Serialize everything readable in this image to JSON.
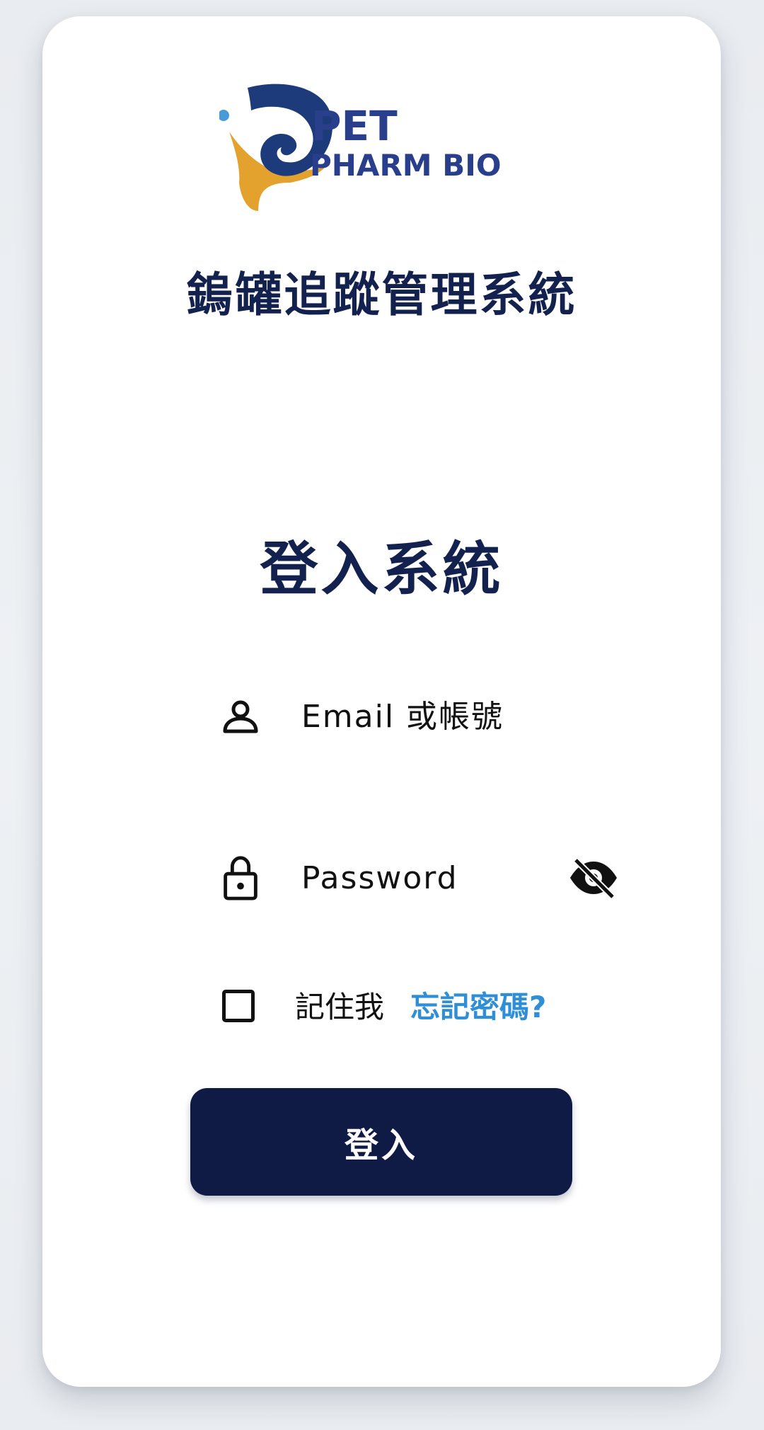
{
  "brand": {
    "logo_icon": "pet-pharm-bio-logo",
    "logo_line1": "PET",
    "logo_line2": "PHARM BIO",
    "colors": {
      "navy": "#13214f",
      "gold": "#e3a12e",
      "accent_blue": "#2f8fd6",
      "button": "#0f1a45"
    }
  },
  "header": {
    "app_title": "鎢罐追蹤管理系統"
  },
  "login": {
    "title": "登入系統",
    "email": {
      "placeholder": "Email 或帳號",
      "value": "",
      "icon": "user-icon"
    },
    "password": {
      "placeholder": "Password",
      "value": "",
      "icon": "lock-icon",
      "toggle_icon": "eye-off-icon"
    },
    "remember_me_label": "記住我",
    "remember_me_checked": false,
    "forgot_password_label": "忘記密碼?",
    "submit_label": "登入"
  }
}
